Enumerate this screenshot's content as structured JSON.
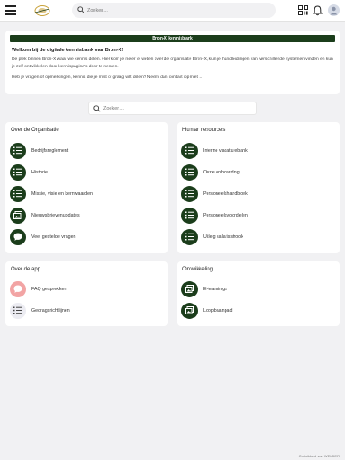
{
  "topbar": {
    "logo_text": "BRON-X",
    "search_placeholder": "Zoeken..."
  },
  "welcome": {
    "banner": "Bron-X kennisbank",
    "title": "Welkom bij de digitale kennisbank van Bron-X!",
    "paragraph1": "De plek binnen Bron-X waar we kennis delen. Hier kom je meer te weten over de organisatie Bron-X, kun je handleidingen van verschillende systemen vinden en kun je zelf ontwikkelen door kennispagina's door te nemen.",
    "paragraph2": "Heb je vragen of opmerkingen, kennis die je mist of graag wilt delen? Neem dan contact op met ..."
  },
  "search": {
    "placeholder": "Zoeken..."
  },
  "sections": {
    "organisatie": {
      "title": "Over de Organisatie",
      "items": [
        {
          "label": "Bedrijfsreglement",
          "icon": "list-icon"
        },
        {
          "label": "Historie",
          "icon": "list-icon"
        },
        {
          "label": "Missie, visie en kernwaarden",
          "icon": "list-icon"
        },
        {
          "label": "Nieuwsbrievenupdates",
          "icon": "images-icon"
        },
        {
          "label": "Veel gestelde vragen",
          "icon": "chat-icon"
        }
      ]
    },
    "hr": {
      "title": "Human resources",
      "items": [
        {
          "label": "Interne vacaturebank",
          "icon": "list-icon"
        },
        {
          "label": "Onze onboarding",
          "icon": "list-icon"
        },
        {
          "label": "Personeelshandboek",
          "icon": "list-icon"
        },
        {
          "label": "Personeelsvoordelen",
          "icon": "list-icon"
        },
        {
          "label": "Uitleg salarisstrook",
          "icon": "list-icon"
        }
      ]
    },
    "app": {
      "title": "Over de app",
      "items": [
        {
          "label": "FAQ gesprekken",
          "icon": "chat-icon"
        },
        {
          "label": "Gedragsrichtlijnen",
          "icon": "list-icon"
        }
      ]
    },
    "ontwikkeling": {
      "title": "Ontwikkeling",
      "items": [
        {
          "label": "E-learnings",
          "icon": "images-icon"
        },
        {
          "label": "Loopbaanpad",
          "icon": "images-icon"
        }
      ]
    }
  },
  "footer": {
    "text": "Ontwikkeld van WELDER"
  },
  "colors": {
    "brand_green": "#1b3d1b",
    "faq_pink": "#f2a4a4",
    "light_icon_bg": "#ececf2",
    "page_bg": "#f1f1f3"
  }
}
